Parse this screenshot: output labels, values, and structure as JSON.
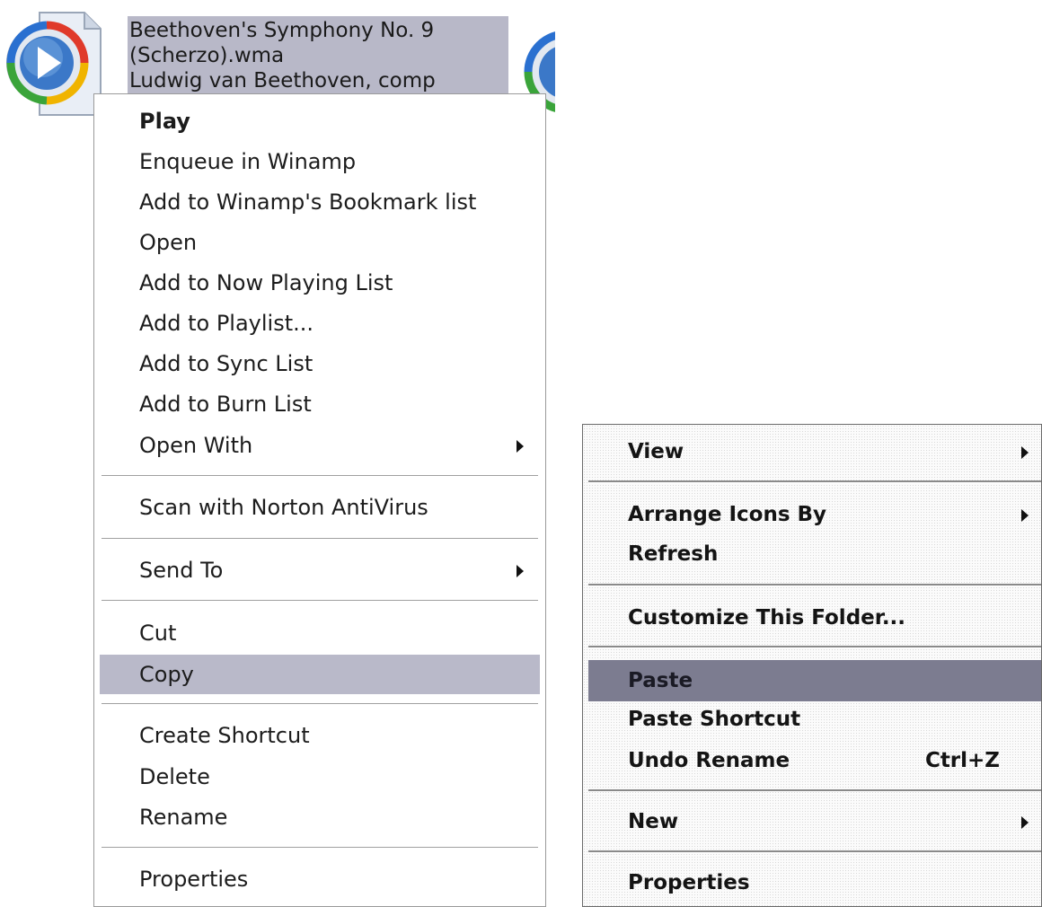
{
  "file": {
    "name_line1": "Beethoven's Symphony No. 9",
    "name_line2": "(Scherzo).wma",
    "name_line3": "Ludwig van Beethoven, comp",
    "icon": "windows-media-audio-icon"
  },
  "file_menu": {
    "items": [
      {
        "label": "Play"
      },
      {
        "label": "Enqueue in Winamp"
      },
      {
        "label": "Add to Winamp's Bookmark list"
      },
      {
        "label": "Open"
      },
      {
        "label": "Add to Now Playing List"
      },
      {
        "label": "Add to Playlist..."
      },
      {
        "label": "Add to Sync List"
      },
      {
        "label": "Add to Burn List"
      },
      {
        "label": "Open With"
      },
      {
        "label": "Scan with Norton AntiVirus"
      },
      {
        "label": "Send To"
      },
      {
        "label": "Cut"
      },
      {
        "label": "Copy"
      },
      {
        "label": "Create Shortcut"
      },
      {
        "label": "Delete"
      },
      {
        "label": "Rename"
      },
      {
        "label": "Properties"
      }
    ],
    "highlighted": "Copy"
  },
  "desktop_menu": {
    "items": [
      {
        "label": "View"
      },
      {
        "label": "Arrange Icons By"
      },
      {
        "label": "Refresh"
      },
      {
        "label": "Customize This Folder..."
      },
      {
        "label": "Paste"
      },
      {
        "label": "Paste Shortcut"
      },
      {
        "label": "Undo Rename",
        "shortcut": "Ctrl+Z"
      },
      {
        "label": "New"
      },
      {
        "label": "Properties"
      }
    ],
    "highlighted": "Paste"
  },
  "colors": {
    "file_menu_highlight": "#b9b9c9",
    "desktop_menu_highlight": "#7c7c90",
    "label_selection": "#b8b8c8"
  }
}
